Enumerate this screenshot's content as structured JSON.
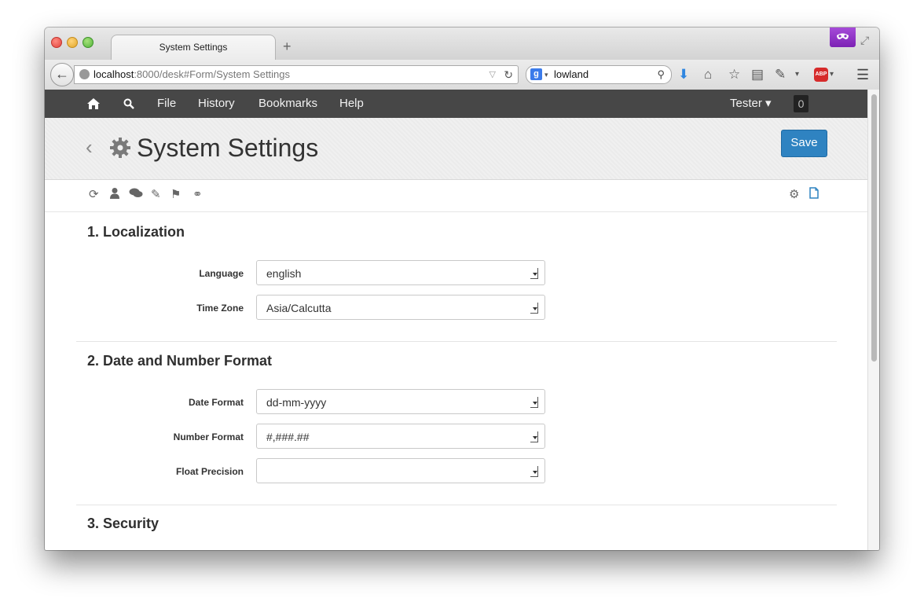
{
  "browser": {
    "tab_title": "System Settings",
    "new_tab": "+",
    "url_host": "localhost",
    "url_rest": ":8000/desk#Form/System Settings",
    "search_value": "lowland",
    "search_engine_letter": "g",
    "abp_label": "ABP"
  },
  "appnav": {
    "file": "File",
    "history": "History",
    "bookmarks": "Bookmarks",
    "help": "Help",
    "user": "Tester ▾",
    "notifications": "0"
  },
  "page": {
    "title": "System Settings",
    "save_label": "Save"
  },
  "sections": {
    "localization": {
      "title": "1. Localization",
      "language_label": "Language",
      "language_value": "english",
      "timezone_label": "Time Zone",
      "timezone_value": "Asia/Calcutta"
    },
    "format": {
      "title": "2. Date and Number Format",
      "date_label": "Date Format",
      "date_value": "dd-mm-yyyy",
      "number_label": "Number Format",
      "number_value": "#,###.##",
      "float_label": "Float Precision",
      "float_value": ""
    },
    "security": {
      "title": "3. Security"
    }
  },
  "colors": {
    "appbar": "#474747",
    "save_button": "#2f83c1",
    "mask_button": "#8b2fc5"
  }
}
